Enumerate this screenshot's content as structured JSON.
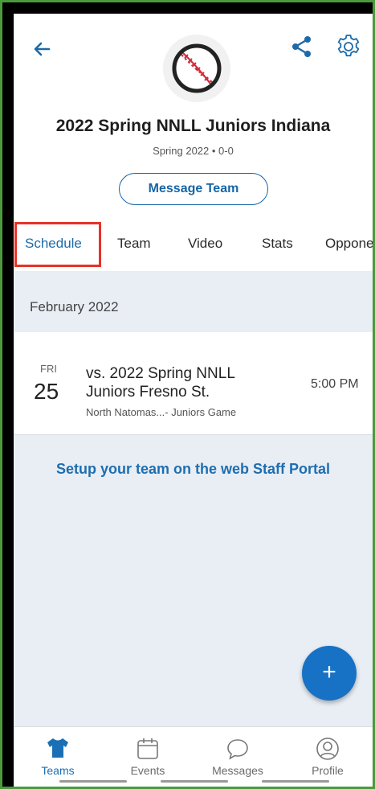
{
  "header": {
    "team_name": "2022 Spring NNLL Juniors Indiana",
    "season_record": "Spring 2022 • 0-0",
    "message_button": "Message Team",
    "icons": {
      "back": "back-arrow-icon",
      "share": "share-icon",
      "settings": "gear-icon",
      "logo": "baseball-icon"
    }
  },
  "tabs": [
    {
      "label": "Schedule",
      "active": true
    },
    {
      "label": "Team",
      "active": false
    },
    {
      "label": "Video",
      "active": false
    },
    {
      "label": "Stats",
      "active": false
    },
    {
      "label": "Opponents",
      "active": false
    }
  ],
  "schedule": {
    "month": "February 2022",
    "events": [
      {
        "day_of_week": "FRI",
        "day": "25",
        "title": "vs. 2022 Spring NNLL Juniors Fresno St.",
        "location": "North Natomas...- Juniors Game",
        "time": "5:00 PM"
      }
    ],
    "portal_link": "Setup your team on the web Staff Portal"
  },
  "fab": {
    "label": "+"
  },
  "bottom_nav": [
    {
      "label": "Teams",
      "icon": "jersey-icon",
      "active": true
    },
    {
      "label": "Events",
      "icon": "calendar-icon",
      "active": false
    },
    {
      "label": "Messages",
      "icon": "chat-bubble-icon",
      "active": false
    },
    {
      "label": "Profile",
      "icon": "profile-icon",
      "active": false
    }
  ],
  "colors": {
    "accent": "#1d6aa8",
    "highlight": "#e53327",
    "background": "#e9eef5"
  }
}
